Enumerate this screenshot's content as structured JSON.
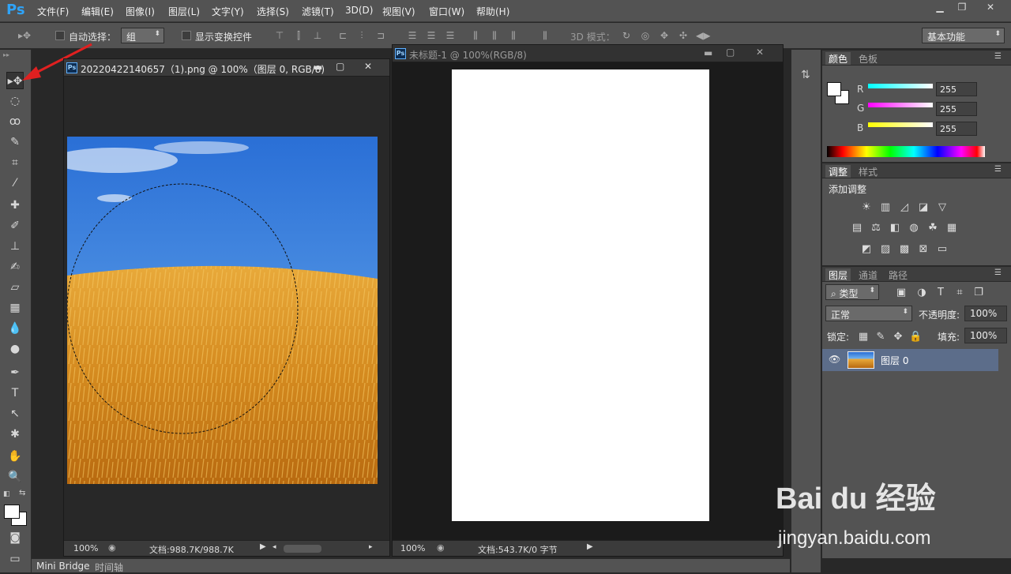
{
  "app": {
    "logo": "Ps"
  },
  "menu": [
    "文件(F)",
    "编辑(E)",
    "图像(I)",
    "图层(L)",
    "文字(Y)",
    "选择(S)",
    "滤镜(T)",
    "3D(D)",
    "视图(V)",
    "窗口(W)",
    "帮助(H)"
  ],
  "options": {
    "auto_select_label": "自动选择：",
    "auto_select_value": "组",
    "show_transform_label": "显示变换控件",
    "mode_3d_label": "3D 模式：",
    "workspace": "基本功能"
  },
  "doc1": {
    "title": "20220422140657（1).png @ 100%（图层 0, RGB/8)",
    "zoom": "100%",
    "doc_size": "文档:988.7K/988.7K"
  },
  "doc2": {
    "title": "未标题-1 @ 100%(RGB/8)",
    "zoom": "100%",
    "doc_size": "文档:543.7K/0 字节"
  },
  "color_panel": {
    "tabs": [
      "颜色",
      "色板"
    ],
    "r_label": "R",
    "g_label": "G",
    "b_label": "B",
    "r": "255",
    "g": "255",
    "b": "255"
  },
  "adjust_panel": {
    "tabs": [
      "调整",
      "样式"
    ],
    "heading": "添加调整"
  },
  "layers_panel": {
    "tabs": [
      "图层",
      "通道",
      "路径"
    ],
    "filter": "类型",
    "blend_mode": "正常",
    "opacity_label": "不透明度:",
    "opacity": "100%",
    "lock_label": "锁定:",
    "fill_label": "填充:",
    "fill": "100%",
    "layer_name": "图层 0"
  },
  "bottom_tabs": [
    "Mini Bridge",
    "时间轴"
  ],
  "watermark": {
    "brand": "Bai du 经验",
    "url": "jingyan.baidu.com"
  },
  "colors": {
    "bg": "#282828",
    "panel": "#535353",
    "arrow": "#e02020"
  }
}
